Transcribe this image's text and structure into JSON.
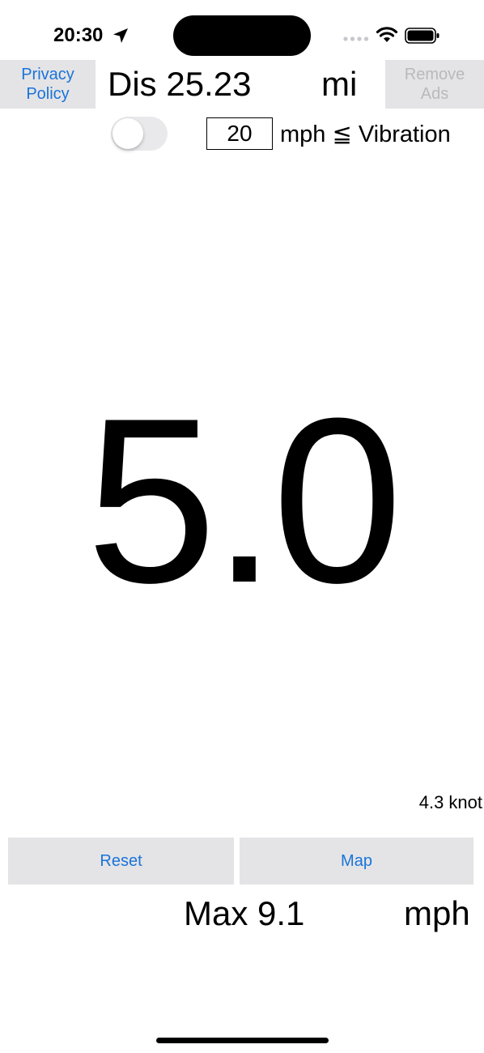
{
  "status_bar": {
    "time": "20:30",
    "icons": [
      "location-arrow-icon",
      "cellular-signal-icon",
      "wifi-icon",
      "battery-icon"
    ]
  },
  "header": {
    "privacy_policy_line1": "Privacy",
    "privacy_policy_line2": "Policy",
    "distance_text": "Dis 25.23",
    "distance_unit": "mi",
    "remove_ads_line1": "Remove",
    "remove_ads_line2": "Ads"
  },
  "vibration": {
    "enabled": false,
    "threshold_value": "20",
    "label": "mph ≦ Vibration"
  },
  "speed": {
    "value": "5.0",
    "knot_text": "4.3 knot"
  },
  "actions": {
    "reset_label": "Reset",
    "map_label": "Map"
  },
  "max": {
    "text": "Max 9.1",
    "unit": "mph"
  },
  "colors": {
    "accent": "#1a73d9",
    "button_bg": "#e4e4e6",
    "disabled_text": "#b9b9bd"
  }
}
